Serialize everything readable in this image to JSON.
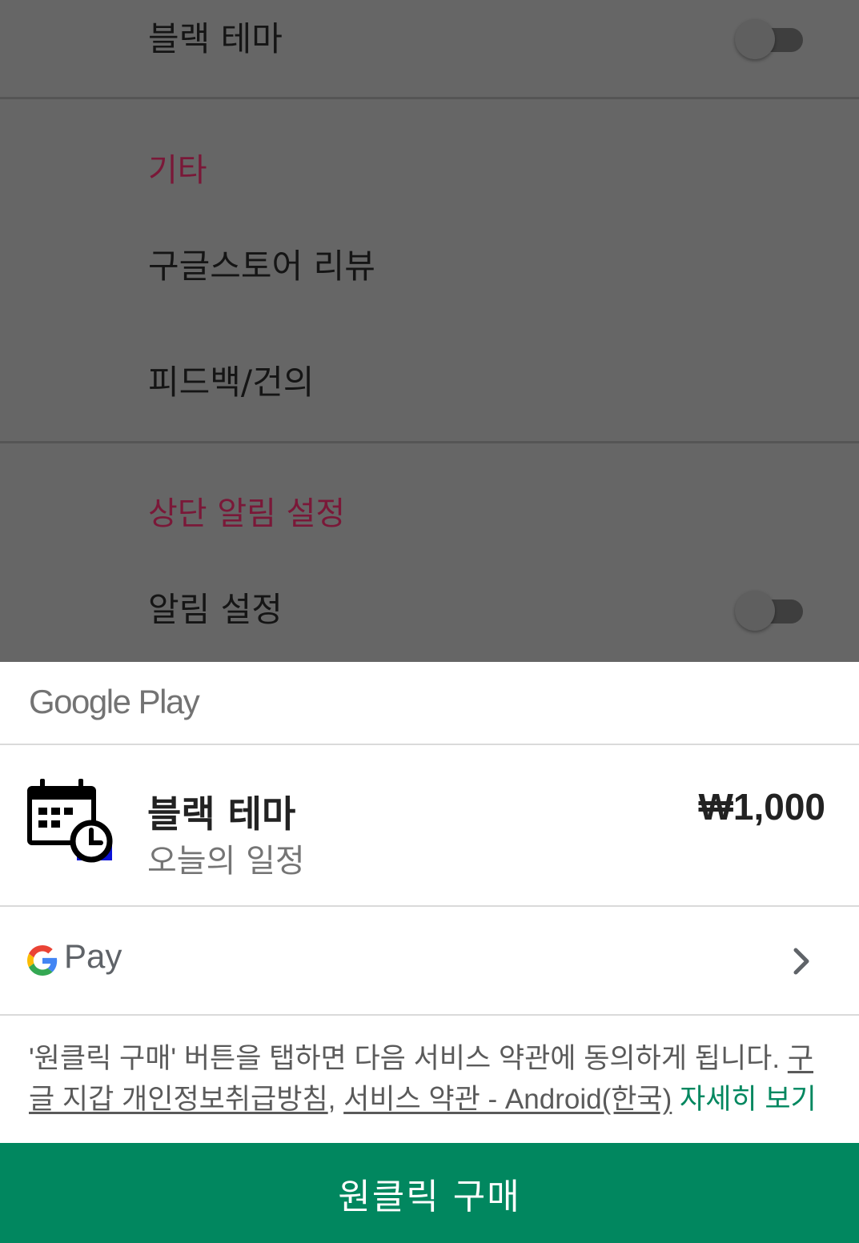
{
  "settings": {
    "black_theme_label": "블랙 테마",
    "black_theme_enabled": false,
    "section_other": "기타",
    "review_label": "구글스토어 리뷰",
    "feedback_label": "피드백/건의",
    "section_top_notification": "상단 알림 설정",
    "notification_label": "알림 설정",
    "notification_enabled": false
  },
  "purchase_sheet": {
    "store_brand": "Google Play",
    "product": {
      "title": "블랙 테마",
      "app_name": "오늘의 일정",
      "price": "₩1,000",
      "icon": "calendar-clock-icon"
    },
    "payment_method": {
      "brand": "Pay",
      "icon": "google-g-icon"
    },
    "terms": {
      "text": "'원클릭 구매' 버튼을 탭하면 다음 서비스 약관에 동의하게 됩니다. ",
      "link_wallet_privacy": "구글 지갑 개인정보취급방침",
      "separator": ", ",
      "link_tos": "서비스 약관 - Android(한국)",
      "space": " ",
      "learn_more": "자세히 보기"
    },
    "buy_button_label": "원클릭 구매"
  },
  "colors": {
    "accent_green": "#01875f",
    "section_header": "#7a1838",
    "overlay": "#666666"
  }
}
